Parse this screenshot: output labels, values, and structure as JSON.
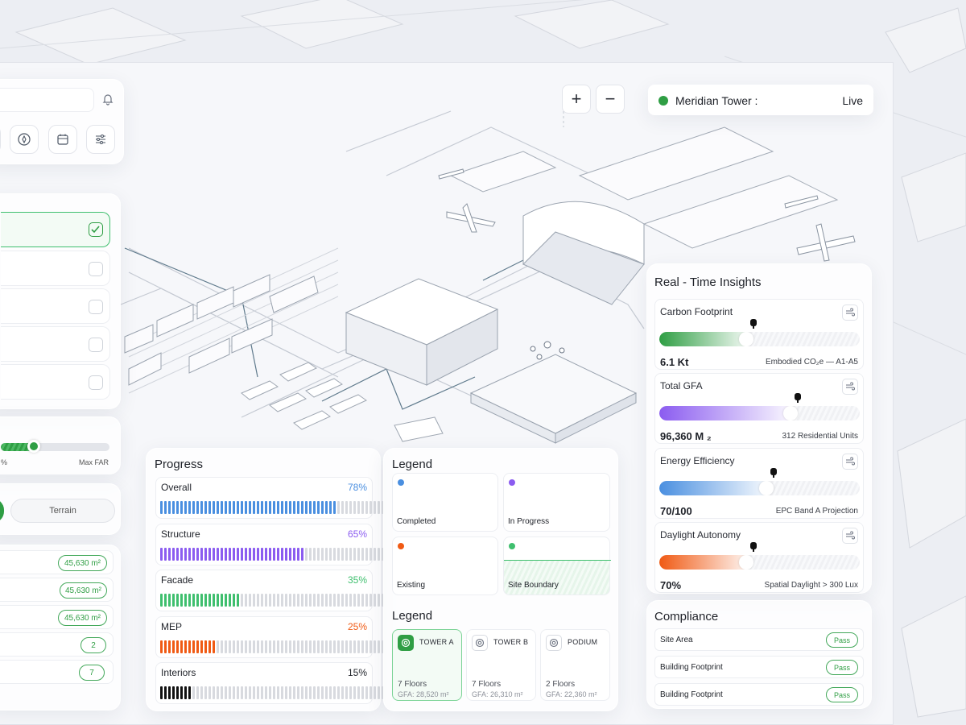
{
  "header": {
    "tower_name": "Meridian Tower :",
    "status": "Live",
    "status_color": "#2f9e44"
  },
  "zoom": {
    "in_label": "+",
    "out_label": "−"
  },
  "toolbar": {
    "icons": [
      "bell-icon",
      "compass-icon",
      "calendar-icon",
      "sliders-icon"
    ]
  },
  "layers": {
    "checked": [
      true,
      false,
      false,
      false,
      false
    ]
  },
  "far_slider": {
    "left_label": "%",
    "right_label": "Max FAR",
    "value_fraction": 0.3
  },
  "view_toggle": {
    "terrain_label": "Terrain"
  },
  "area_pills": [
    "45,630 m²",
    "45,630 m²",
    "45,630 m²",
    "2",
    "7"
  ],
  "progress": {
    "title": "Progress",
    "items": [
      {
        "label": "Overall",
        "pct": "78%",
        "value": 0.78,
        "color": "#4a8fe0"
      },
      {
        "label": "Structure",
        "pct": "65%",
        "value": 0.65,
        "color": "#8b5cf0"
      },
      {
        "label": "Facade",
        "pct": "35%",
        "value": 0.35,
        "color": "#3fbf6e"
      },
      {
        "label": "MEP",
        "pct": "25%",
        "value": 0.25,
        "color": "#f05a14"
      },
      {
        "label": "Interiors",
        "pct": "15%",
        "value": 0.15,
        "color": "#111111"
      }
    ]
  },
  "legend": {
    "title": "Legend",
    "items": [
      {
        "label": "Completed",
        "color": "#4a8fe0"
      },
      {
        "label": "In Progress",
        "color": "#8b5cf0"
      },
      {
        "label": "Existing",
        "color": "#f05a14"
      },
      {
        "label": "Site Boundary",
        "color": "#3fbf6e"
      }
    ]
  },
  "legend2": {
    "title": "Legend",
    "towers": [
      {
        "name": "TOWER A",
        "floors": "7 Floors",
        "gfa": "GFA: 28,520 m²",
        "active": true
      },
      {
        "name": "TOWER B",
        "floors": "7 Floors",
        "gfa": "GFA: 26,310 m²",
        "active": false
      },
      {
        "name": "PODIUM",
        "floors": "2 Floors",
        "gfa": "GFA: 22,360 m²",
        "active": false
      }
    ]
  },
  "insights": {
    "title": "Real - Time Insights",
    "items": [
      {
        "title": "Carbon Footprint",
        "value": "6.1 Kt",
        "note": "Embodied CO₂e — A1-A5",
        "level": 0.47,
        "gradient": [
          "#2f9e44",
          "#ffffff"
        ]
      },
      {
        "title": "Total GFA",
        "value": "96,360 M ₂",
        "note": "312 Residential Units",
        "level": 0.69,
        "gradient": [
          "#8b5cf0",
          "#ffffff"
        ]
      },
      {
        "title": "Energy Efficiency",
        "value": "70/100",
        "note": "EPC Band A Projection",
        "level": 0.57,
        "gradient": [
          "#4a8fe0",
          "#ffffff"
        ]
      },
      {
        "title": "Daylight Autonomy",
        "value": "70%",
        "note": "Spatial Daylight > 300 Lux",
        "level": 0.47,
        "gradient": [
          "#f05a14",
          "#ffffff"
        ]
      }
    ]
  },
  "compliance": {
    "title": "Compliance",
    "rows": [
      {
        "label": "Site Area",
        "status": "Pass"
      },
      {
        "label": "Building Footprint",
        "status": "Pass"
      },
      {
        "label": "Building Footprint",
        "status": "Pass"
      }
    ]
  }
}
